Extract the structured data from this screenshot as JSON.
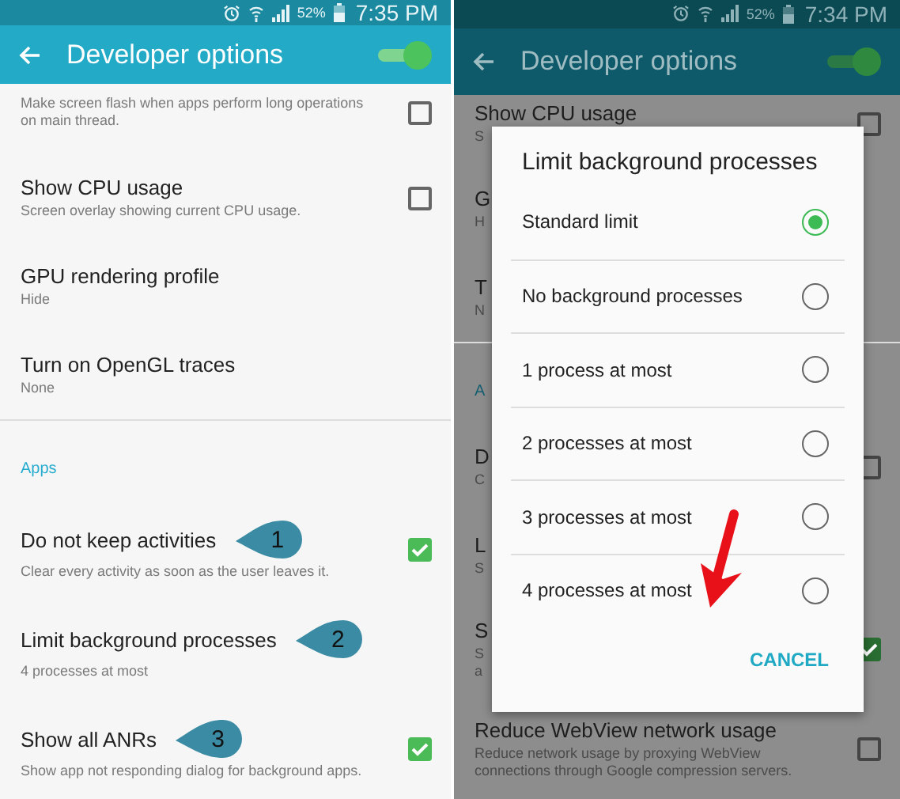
{
  "phones": [
    {
      "status_bar": {
        "battery": "52%",
        "time": "7:35 PM"
      },
      "toolbar": {
        "title": "Developer options",
        "switch_on": true
      },
      "rows": [
        {
          "kind": "setting",
          "summary": "Make screen flash when apps perform long operations on main thread.",
          "checked": false
        },
        {
          "kind": "setting",
          "title": "Show CPU usage",
          "summary": "Screen overlay showing current CPU usage.",
          "checked": false
        },
        {
          "kind": "setting",
          "title": "GPU rendering profile",
          "summary": "Hide"
        },
        {
          "kind": "setting",
          "title": "Turn on OpenGL traces",
          "summary": "None"
        },
        {
          "kind": "section",
          "title": "Apps"
        },
        {
          "kind": "setting",
          "title": "Do not keep activities",
          "summary": "Clear every activity as soon as the user leaves it.",
          "checked": true,
          "callout": "1"
        },
        {
          "kind": "setting",
          "title": "Limit background processes",
          "summary": "4 processes at most",
          "callout": "2"
        },
        {
          "kind": "setting",
          "title": "Show all ANRs",
          "summary": "Show app not responding dialog for background apps.",
          "checked": true,
          "callout": "3"
        }
      ]
    },
    {
      "status_bar": {
        "battery": "52%",
        "time": "7:34 PM"
      },
      "toolbar": {
        "title": "Developer options",
        "switch_on": true
      },
      "rows": [
        {
          "kind": "setting",
          "title": "Show CPU usage",
          "summary": "S",
          "checked": false
        },
        {
          "kind": "setting",
          "title": "G",
          "summary": "H"
        },
        {
          "kind": "setting",
          "title": "T",
          "summary": "N"
        },
        {
          "kind": "section",
          "title": "A"
        },
        {
          "kind": "setting",
          "title": "D",
          "summary": "C",
          "checked": false
        },
        {
          "kind": "setting",
          "title": "L",
          "summary": "S"
        },
        {
          "kind": "setting",
          "title": "S",
          "summary": "S\na",
          "checked": true
        },
        {
          "kind": "setting",
          "title": "Reduce WebView network usage",
          "summary": "Reduce network usage by proxying WebView connections through Google compression servers.",
          "checked": false
        }
      ],
      "dialog": {
        "title": "Limit background processes",
        "options": [
          {
            "label": "Standard limit",
            "selected": true,
            "arrow": false
          },
          {
            "label": "No background processes",
            "selected": false,
            "arrow": false
          },
          {
            "label": "1 process at most",
            "selected": false,
            "arrow": false
          },
          {
            "label": "2 processes at most",
            "selected": false,
            "arrow": false
          },
          {
            "label": "3 processes at most",
            "selected": false,
            "arrow": false
          },
          {
            "label": "4 processes at most",
            "selected": false,
            "arrow": true
          }
        ],
        "button": "CANCEL"
      }
    }
  ]
}
